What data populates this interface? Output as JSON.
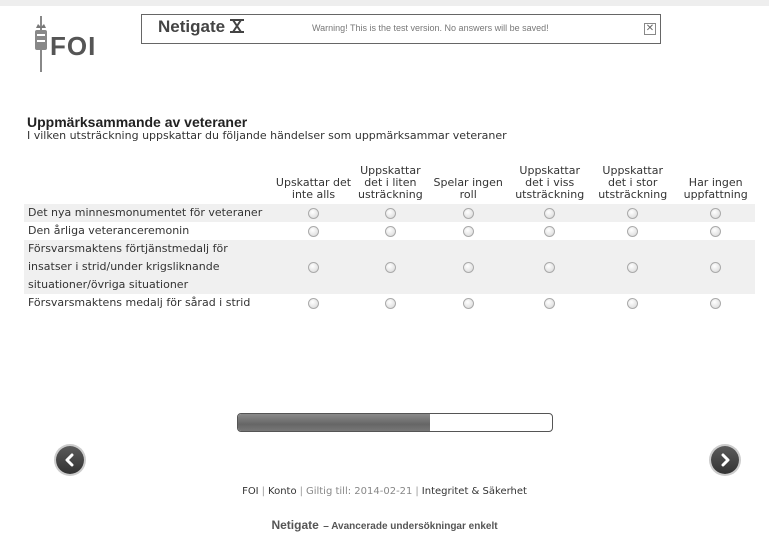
{
  "header": {
    "logo_text": "FOI",
    "brand": "Netigate",
    "warning": "Warning! This is the test version. No answers will be saved!",
    "close_glyph": "✕"
  },
  "question": {
    "title": "Uppmärksammande av veteraner",
    "subtitle": "I vilken utsträckning uppskattar du följande händelser som uppmärksammar veteraner"
  },
  "columns": [
    "Upskattar det inte alls",
    "Uppskattar det i liten usträckning",
    "Spelar ingen roll",
    "Uppskattar det i viss utsträckning",
    "Uppskattar det i stor utsträckning",
    "Har ingen uppfattning"
  ],
  "column_lines": [
    [
      "Upskattar det",
      "inte alls"
    ],
    [
      "Uppskattar",
      "det i liten",
      "usträckning"
    ],
    [
      "Spelar ingen",
      "roll"
    ],
    [
      "Uppskattar",
      "det i viss",
      "utsträckning"
    ],
    [
      "Uppskattar",
      "det i stor",
      "utsträckning"
    ],
    [
      "Har ingen",
      "uppfattning"
    ]
  ],
  "rows": [
    {
      "label_lines": [
        "Det nya minnesmonumentet för veteraner"
      ]
    },
    {
      "label_lines": [
        "Den årliga veteranceremonin"
      ]
    },
    {
      "label_lines": [
        "Försvarsmaktens förtjänstmedalj för",
        "insatser i strid/under krigsliknande",
        "situationer/övriga situationer"
      ]
    },
    {
      "label_lines": [
        "Försvarsmaktens medalj för sårad i strid"
      ]
    }
  ],
  "progress": {
    "fraction": 0.61
  },
  "nav": {
    "prev_icon": "chevron-left-icon",
    "next_icon": "chevron-right-icon"
  },
  "footer": {
    "org": "FOI",
    "konto": "Konto",
    "valid": "Giltig till: 2014-02-21",
    "privacy": "Integritet & Säkerhet",
    "brand": "Netigate",
    "tagline": "Avancerade undersökningar enkelt"
  },
  "colors": {
    "progress_fill": "#6e6e6e",
    "nav_button": "#444444",
    "row_shade": "#f0f0f0"
  }
}
